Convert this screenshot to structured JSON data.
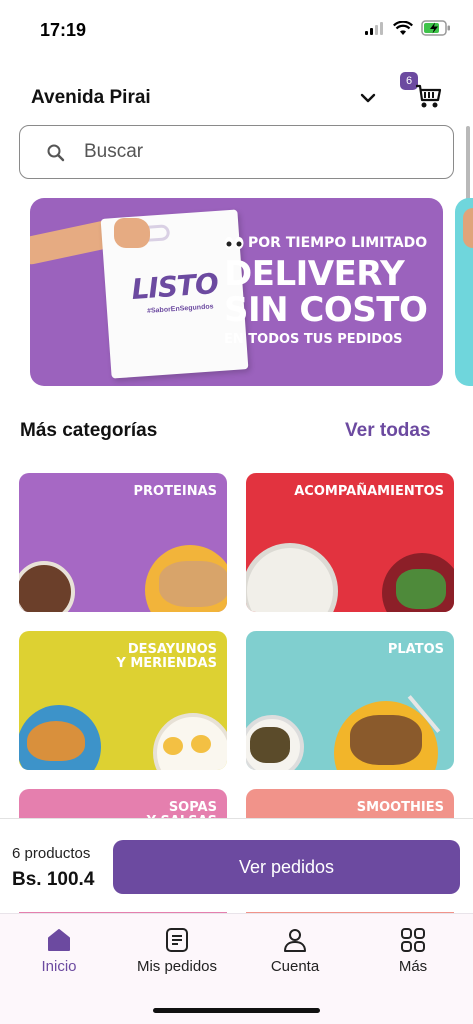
{
  "status": {
    "time": "17:19"
  },
  "header": {
    "address": "Avenida Pirai",
    "cart_count": "6"
  },
  "search": {
    "placeholder": "Buscar"
  },
  "banner": {
    "bag_brand": "LISTO",
    "bag_tag": "#SaborEnSegundos",
    "line1": "POR TIEMPO LIMITADO",
    "line2a": "DELIVERY",
    "line2b": "SIN COSTO",
    "line3": "EN TODOS TUS PEDIDOS"
  },
  "categories_section": {
    "title": "Más categorías",
    "see_all": "Ver todas",
    "items": [
      {
        "label": "PROTEINAS",
        "color": "#a668c4"
      },
      {
        "label": "ACOMPAÑAMIENTOS",
        "color": "#e2333f"
      },
      {
        "label": "DESAYUNOS\nY MERIENDAS",
        "color": "#ddd132"
      },
      {
        "label": "PLATOS",
        "color": "#80cfcf"
      },
      {
        "label": "SOPAS\nY SALSAS",
        "color": "#e57fae"
      },
      {
        "label": "SMOOTHIES",
        "color": "#f1938a"
      }
    ]
  },
  "cart_bar": {
    "count": "6 productos",
    "total": "Bs. 100.4",
    "button": "Ver pedidos"
  },
  "nav": {
    "items": [
      {
        "label": "Inicio",
        "icon": "home-icon"
      },
      {
        "label": "Mis pedidos",
        "icon": "orders-icon"
      },
      {
        "label": "Cuenta",
        "icon": "account-icon"
      },
      {
        "label": "Más",
        "icon": "grid-icon"
      }
    ]
  },
  "colors": {
    "brand": "#6c4aa0",
    "banner": "#9b62bd"
  }
}
